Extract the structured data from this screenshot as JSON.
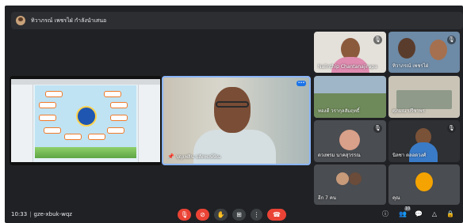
{
  "presenter": {
    "label": "ทิวาภรณ์ เพชรไฝ่ กำลังนำเสนอ"
  },
  "meeting": {
    "time": "10:33",
    "separator": "|",
    "code": "gze-xbuk-wqz"
  },
  "tiles": {
    "main_speaker": {
      "name": "บุญเพลิน ปลัดพงษ์ษิณ"
    },
    "side": [
      {
        "name": "Nalinthip Chantanajirapa"
      },
      {
        "name": "ทิวาภรณ์ เพชรไฝ่"
      },
      {
        "name": "ทองดี วรากุลสัมฤทธิ์"
      },
      {
        "name": "ศุภมณ ปรีชาพร"
      },
      {
        "name": "ดวงพรม นาคสุวรรณ"
      },
      {
        "name": "นิลชา ตลอดวงศ์"
      },
      {
        "name": "อีก 7 คน"
      },
      {
        "name": "คุณ"
      }
    ]
  },
  "controls": {
    "mic": "mic-off-icon",
    "camera": "camera-off-icon",
    "hand": "raise-hand-icon",
    "present": "present-icon",
    "more": "more-options-icon",
    "leave": "end-call-icon"
  },
  "right_controls": {
    "participant_count": "10"
  },
  "colors": {
    "leave": "#ea4335",
    "background": "#202124",
    "accent": "#8ab4f8"
  }
}
